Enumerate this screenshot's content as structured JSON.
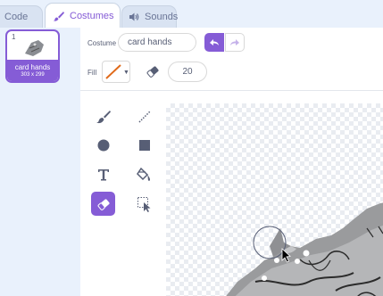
{
  "tabs": {
    "code_label": "Code",
    "costumes_label": "Costumes",
    "sounds_label": "Sounds"
  },
  "costume_list": {
    "items": [
      {
        "index": "1",
        "name": "card hands",
        "size": "303 x 299"
      }
    ]
  },
  "toolbar": {
    "costume_label": "Costume",
    "costume_name": "card hands",
    "fill_label": "Fill",
    "eraser_size": "20"
  },
  "colors": {
    "accent": "#855cd6",
    "fill_stroke": "#e06a1a"
  },
  "icons": {
    "undo": "undo-icon",
    "redo": "redo-icon",
    "brush": "brush-icon",
    "line": "line-icon",
    "circle": "circle-icon",
    "rectangle": "rectangle-icon",
    "text": "text-icon",
    "fill": "fill-icon",
    "eraser": "eraser-icon",
    "select": "select-icon"
  }
}
